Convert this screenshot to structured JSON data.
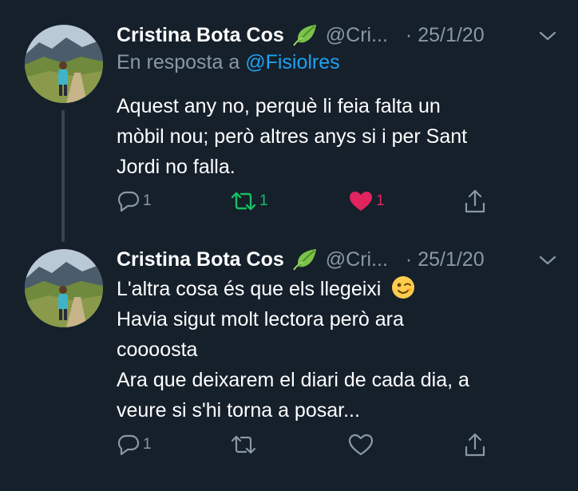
{
  "colors": {
    "background": "#15202b",
    "muted": "#8899a6",
    "accent_blue": "#1da1f2",
    "retweet_green": "#17bf63",
    "like_pink": "#e0245e"
  },
  "tweets": [
    {
      "author_name": "Cristina Bota Cos",
      "author_badge_icon": "leaf-icon",
      "handle": "@Cri...",
      "date": "· 25/1/20",
      "reply_prefix": "En resposta a",
      "reply_mention": "@Fisiolres",
      "lines": [
        "Aquest any no, perquè li feia falta un",
        "mòbil nou; però altres anys si i per Sant",
        "Jordi no falla."
      ],
      "reply_count": "1",
      "retweet_count": "1",
      "like_count": "1",
      "retweeted": true,
      "liked": true
    },
    {
      "author_name": "Cristina Bota Cos",
      "author_badge_icon": "leaf-icon",
      "handle": "@Cri...",
      "date": "· 25/1/20",
      "lines": [
        "L'altra cosa és que els llegeixi",
        "Havia sigut molt lectora però ara",
        "coooosta",
        "Ara que deixarem el diari de cada dia, a",
        "veure si s'hi torna a posar..."
      ],
      "emoji_icon": "winking-face-icon",
      "reply_count": "1",
      "retweet_count": "",
      "like_count": "",
      "retweeted": false,
      "liked": false
    }
  ]
}
